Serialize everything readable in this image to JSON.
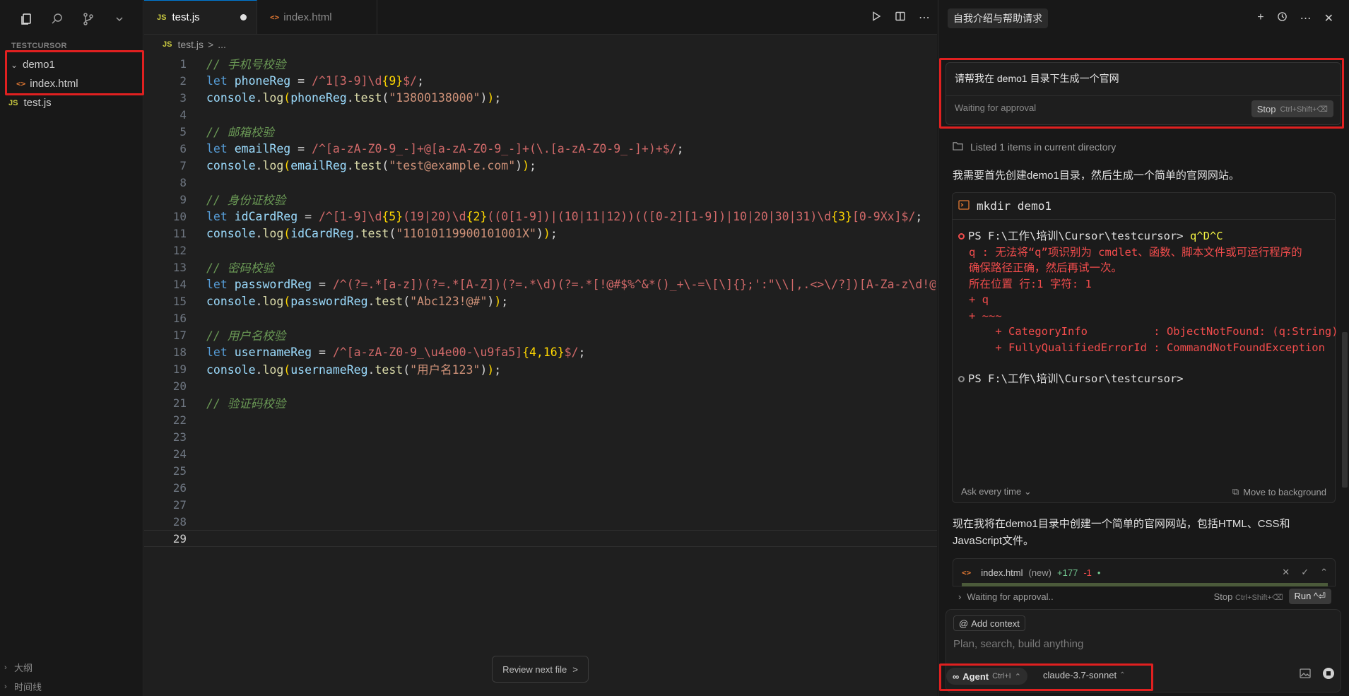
{
  "sidebar": {
    "section_title": "TESTCURSOR",
    "tree": [
      {
        "type": "folder",
        "label": "demo1"
      },
      {
        "type": "file",
        "icon": "<>",
        "label": "index.html"
      },
      {
        "type": "file",
        "icon": "JS",
        "label": "test.js"
      }
    ],
    "bottom": [
      "大纲",
      "时间线"
    ]
  },
  "editor": {
    "tabs": [
      {
        "icon": "JS",
        "label": "test.js",
        "active": true,
        "modified": true
      },
      {
        "icon": "<>",
        "label": "index.html",
        "active": false
      }
    ],
    "breadcrumb": {
      "file": "test.js",
      "sep": ">",
      "more": "..."
    },
    "current_line": 29,
    "review_label": "Review next file",
    "review_chevron": ">"
  },
  "chat": {
    "title": "自我介绍与帮助请求",
    "prompt": "请帮我在 demo1 目录下生成一个官网",
    "status": "Waiting for approval",
    "stop_label": "Stop",
    "stop_shortcut": "Ctrl+Shift+⌫",
    "listed": "Listed 1 items in current directory",
    "message1": "我需要首先创建demo1目录，然后生成一个简单的官网网站。",
    "terminal": {
      "command": "mkdir demo1",
      "lines": [
        {
          "kind": "ps-error",
          "text": "PS F:\\工作\\培训\\Cursor\\testcursor> ",
          "cmd": "q^D^C"
        },
        {
          "kind": "err",
          "text": "q : 无法将“q”项识别为 cmdlet、函数、脚本文件或可运行程序的"
        },
        {
          "kind": "err",
          "text": "确保路径正确，然后再试一次。"
        },
        {
          "kind": "err",
          "text": "所在位置 行:1 字符: 1"
        },
        {
          "kind": "err",
          "text": "+ q"
        },
        {
          "kind": "err",
          "text": "+ ~~~"
        },
        {
          "kind": "err",
          "text": "    + CategoryInfo          : ObjectNotFound: (q:String) "
        },
        {
          "kind": "err",
          "text": "    + FullyQualifiedErrorId : CommandNotFoundException"
        },
        {
          "kind": "blank",
          "text": ""
        },
        {
          "kind": "ps-idle",
          "text": "PS F:\\工作\\培训\\Cursor\\testcursor>"
        }
      ],
      "ask_label": "Ask every time",
      "move_label": "Move to background"
    },
    "message2_line1": "现在我将在demo1目录中创建一个简单的官网网站，包括HTML、CSS和",
    "message2_line2": "JavaScript文件。",
    "file_card": {
      "icon": "<>",
      "name": "index.html",
      "tag": "(new)",
      "added": "+177",
      "removed": "-1",
      "dot": "•"
    },
    "approval": {
      "status": "Waiting for approval..",
      "stop": "Stop",
      "stop_shortcut": "Ctrl+Shift+⌫",
      "run": "Run ^⏎"
    },
    "composer": {
      "add_context": "Add context",
      "placeholder": "Plan, search, build anything",
      "mode": "Agent",
      "mode_shortcut": "Ctrl+I",
      "model": "claude-3.7-sonnet"
    }
  },
  "colors": {
    "accent": "#0078d4",
    "highlight": "#e02020",
    "error": "#f14c4c"
  }
}
